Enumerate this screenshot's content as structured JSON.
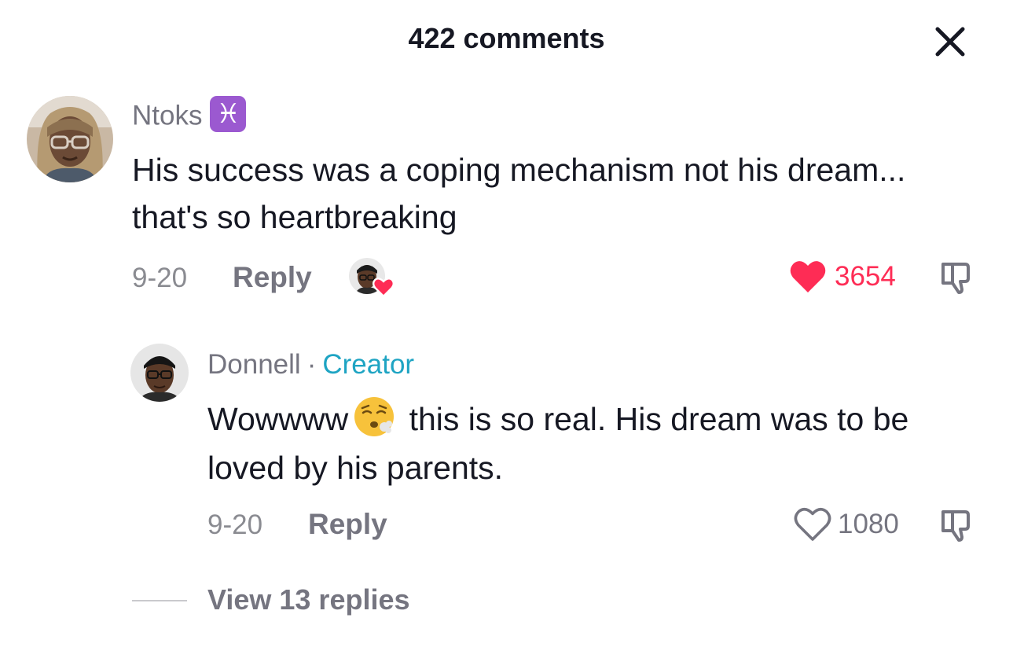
{
  "header": {
    "title": "422 comments",
    "close_icon": "close-icon"
  },
  "comments": [
    {
      "username": "Ntoks",
      "badge": "♓",
      "text": "His success was a coping mechanism not his dream... that's so heartbreaking",
      "date": "9-20",
      "reply_label": "Reply",
      "liked_by_creator": true,
      "likes": "3654",
      "liked": true,
      "like_color": "#fe2c55"
    },
    {
      "username": "Donnell",
      "separator": "·",
      "creator_label": "Creator",
      "text_part1": "Wowwww",
      "text_emoji": "tired-face-emoji",
      "text_part2": " this is so real. His dream was to be loved by his parents.",
      "date": "9-20",
      "reply_label": "Reply",
      "likes": "1080",
      "liked": false
    }
  ],
  "view_replies_label": "View 13 replies",
  "colors": {
    "accent_red": "#fe2c55",
    "creator_blue": "#1ea4c3",
    "muted_text": "#757580"
  }
}
